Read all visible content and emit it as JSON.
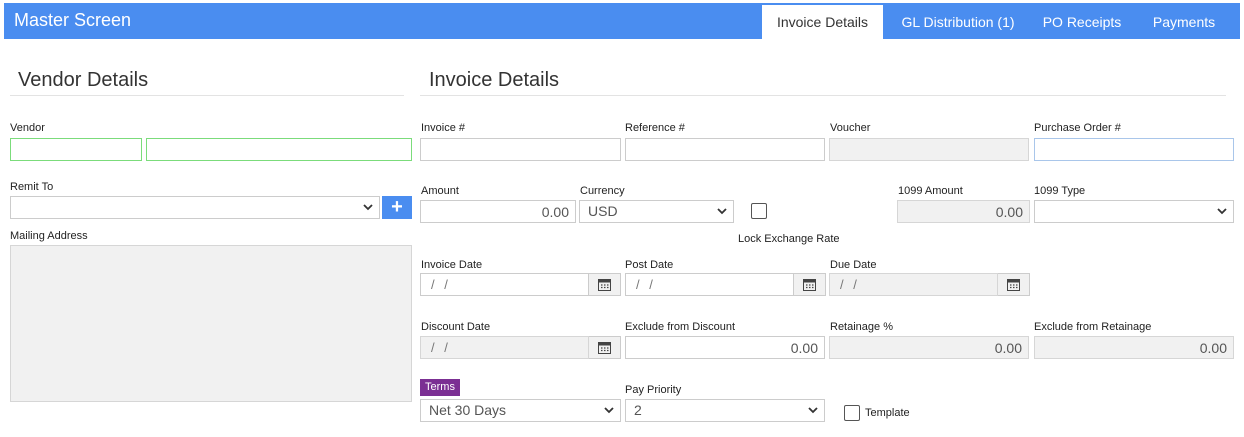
{
  "header": {
    "title": "Master Screen",
    "tabs": [
      {
        "label": "Invoice Details",
        "active": true
      },
      {
        "label": "GL Distribution (1)",
        "active": false
      },
      {
        "label": "PO Receipts",
        "active": false
      },
      {
        "label": "Payments",
        "active": false
      }
    ]
  },
  "vendor_section": {
    "title": "Vendor Details",
    "vendor_label": "Vendor",
    "vendor_code": "",
    "vendor_name": "",
    "remit_to_label": "Remit To",
    "remit_to_value": "",
    "add_icon": "plus-icon",
    "mailing_address_label": "Mailing Address",
    "mailing_address_value": ""
  },
  "invoice_section": {
    "title": "Invoice Details",
    "invoice_no": {
      "label": "Invoice #",
      "value": ""
    },
    "reference_no": {
      "label": "Reference #",
      "value": ""
    },
    "voucher": {
      "label": "Voucher",
      "value": ""
    },
    "purchase_order": {
      "label": "Purchase Order #",
      "value": ""
    },
    "amount": {
      "label": "Amount",
      "value": "0.00"
    },
    "currency": {
      "label": "Currency",
      "value": "USD"
    },
    "lock_exchange_rate": {
      "label": "Lock Exchange Rate",
      "checked": false
    },
    "amount_1099": {
      "label": "1099 Amount",
      "value": "0.00"
    },
    "type_1099": {
      "label": "1099 Type",
      "value": ""
    },
    "invoice_date": {
      "label": "Invoice Date",
      "value": "/ /"
    },
    "post_date": {
      "label": "Post Date",
      "value": "/ /"
    },
    "due_date": {
      "label": "Due Date",
      "value": "/ /"
    },
    "discount_date": {
      "label": "Discount Date",
      "value": "/ /"
    },
    "exclude_from_discount": {
      "label": "Exclude from Discount",
      "value": "0.00"
    },
    "retainage_pct": {
      "label": "Retainage %",
      "value": "0.00"
    },
    "exclude_from_retainage": {
      "label": "Exclude from Retainage",
      "value": "0.00"
    },
    "terms": {
      "label": "Terms",
      "value": "Net 30 Days"
    },
    "pay_priority": {
      "label": "Pay Priority",
      "value": "2"
    },
    "template": {
      "label": "Template",
      "checked": false
    }
  },
  "colors": {
    "header_bg": "#4a8df0",
    "terms_badge": "#7b2f93",
    "required_border": "#7bdc7b",
    "focus_border": "#a9c6ea"
  }
}
